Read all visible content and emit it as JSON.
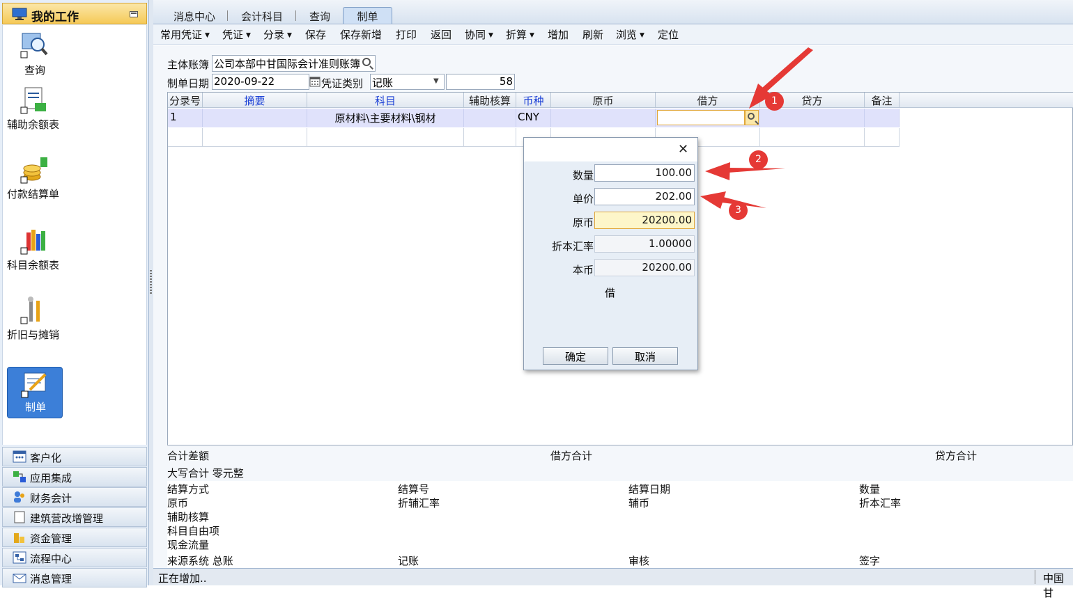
{
  "left": {
    "header_title": "我的工作",
    "shortcuts": [
      {
        "label": "查询"
      },
      {
        "label": "辅助余额表"
      },
      {
        "label": "付款结算单"
      },
      {
        "label": "科目余额表"
      },
      {
        "label": "折旧与摊销"
      },
      {
        "label": "制单"
      }
    ],
    "nav_groups": [
      {
        "label": "客户化",
        "icon": "grid-icon"
      },
      {
        "label": "应用集成",
        "icon": "integration-icon"
      },
      {
        "label": "财务会计",
        "icon": "people-icon"
      },
      {
        "label": "建筑营改增管理",
        "icon": "document-icon"
      },
      {
        "label": "资金管理",
        "icon": "coins-icon"
      },
      {
        "label": "流程中心",
        "icon": "flow-icon"
      },
      {
        "label": "消息管理",
        "icon": "mail-icon"
      }
    ]
  },
  "tabs": [
    "消息中心",
    "会计科目",
    "查询",
    "制单"
  ],
  "active_tab": "制单",
  "toolbar": [
    {
      "label": "常用凭证",
      "dropdown": true
    },
    {
      "label": "凭证",
      "dropdown": true
    },
    {
      "label": "分录",
      "dropdown": true
    },
    {
      "label": "保存",
      "dropdown": false
    },
    {
      "label": "保存新增",
      "dropdown": false
    },
    {
      "label": "打印",
      "dropdown": false
    },
    {
      "label": "返回",
      "dropdown": false
    },
    {
      "label": "协同",
      "dropdown": true
    },
    {
      "label": "折算",
      "dropdown": true
    },
    {
      "label": "增加",
      "dropdown": false
    },
    {
      "label": "刷新",
      "dropdown": false
    },
    {
      "label": "浏览",
      "dropdown": true
    },
    {
      "label": "定位",
      "dropdown": false
    }
  ],
  "form": {
    "book_label": "主体账簿",
    "book_value": "公司本部中甘国际会计准则账簿",
    "date_label": "制单日期",
    "date_value": "2020-09-22",
    "type_label": "凭证类别",
    "type_value": "记账",
    "voucher_no": "58"
  },
  "grid": {
    "columns": [
      "分录号",
      "摘要",
      "科目",
      "辅助核算",
      "币种",
      "原币",
      "借方",
      "贷方",
      "备注"
    ],
    "rows": [
      {
        "no": "1",
        "summary": "",
        "account": "原材料\\主要材料\\钢材",
        "aux": "",
        "currency": "CNY",
        "orig": "",
        "debit": "",
        "credit": "",
        "remark": ""
      }
    ]
  },
  "footer": {
    "diff_label": "合计差额",
    "debit_total_label": "借方合计",
    "credit_total_label": "贷方合计",
    "uppercase_total": "大写合计 零元整",
    "settle_method": "结算方式",
    "settle_no": "结算号",
    "settle_date": "结算日期",
    "quantity": "数量",
    "orig": "原币",
    "aux_rate": "折辅汇率",
    "aux_currency": "辅币",
    "local_rate": "折本汇率",
    "aux_account": "辅助核算",
    "free_item": "科目自由项",
    "cash_flow": "现金流量",
    "source": "来源系统 总账",
    "bookkeep": "记账",
    "audit": "审核",
    "sign": "签字"
  },
  "status": {
    "text": "正在增加..",
    "org": "中国甘"
  },
  "dialog": {
    "fields": [
      {
        "label": "数量",
        "value": "100.00"
      },
      {
        "label": "单价",
        "value": "202.00"
      },
      {
        "label": "原币",
        "value": "20200.00"
      },
      {
        "label": "折本汇率",
        "value": "1.00000"
      },
      {
        "label": "本币",
        "value": "20200.00"
      }
    ],
    "direction": "借",
    "ok": "确定",
    "cancel": "取消"
  },
  "annotations": [
    "1",
    "2",
    "3"
  ],
  "colors": {
    "accent": "#3c7fd8",
    "annotation": "#e53935",
    "selected_row": "#e0e2fb",
    "highlight_field": "#fdf6c9"
  }
}
